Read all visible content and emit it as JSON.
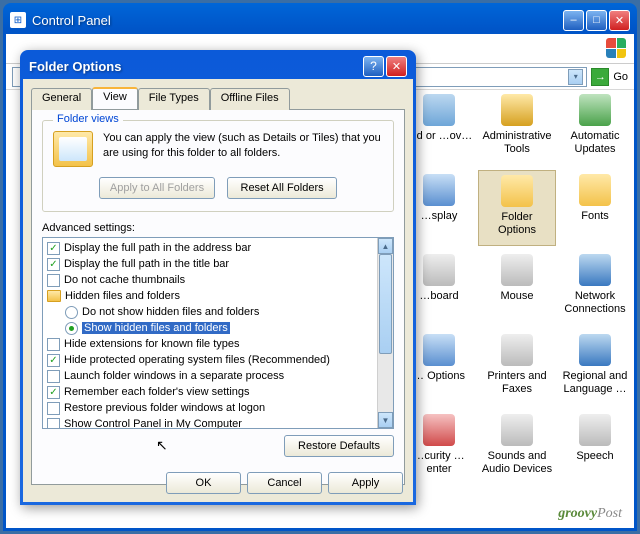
{
  "cp": {
    "title": "Control Panel",
    "go_label": "Go",
    "icons": {
      "r1c1": "…d or …ov…",
      "r1c2": "Administrative Tools",
      "r1c3": "Automatic Updates",
      "r2c1": "…splay",
      "r2c2": "Folder Options",
      "r2c3": "Fonts",
      "r3c1": "…board",
      "r3c2": "Mouse",
      "r3c3": "Network Connections",
      "r4c1": "… Options",
      "r4c2": "Printers and Faxes",
      "r4c3": "Regional and Language …",
      "r5c1": "…curity …enter",
      "r5c2": "Sounds and Audio Devices",
      "r5c3": "Speech"
    }
  },
  "dlg": {
    "title": "Folder Options",
    "tabs": {
      "general": "General",
      "view": "View",
      "filetypes": "File Types",
      "offline": "Offline Files"
    },
    "folder_views": {
      "legend": "Folder views",
      "desc": "You can apply the view (such as Details or Tiles) that you are using for this folder to all folders.",
      "apply_all": "Apply to All Folders",
      "reset_all": "Reset All Folders"
    },
    "advanced_label": "Advanced settings:",
    "tree": {
      "i0": "Display the full path in the address bar",
      "i1": "Display the full path in the title bar",
      "i2": "Do not cache thumbnails",
      "i3": "Hidden files and folders",
      "i4": "Do not show hidden files and folders",
      "i5": "Show hidden files and folders",
      "i6": "Hide extensions for known file types",
      "i7": "Hide protected operating system files (Recommended)",
      "i8": "Launch folder windows in a separate process",
      "i9": "Remember each folder's view settings",
      "i10": "Restore previous folder windows at logon",
      "i11": "Show Control Panel in My Computer"
    },
    "restore_defaults": "Restore Defaults",
    "ok": "OK",
    "cancel": "Cancel",
    "apply": "Apply"
  },
  "watermark": {
    "a": "groovy",
    "b": "Post"
  },
  "colors": {
    "xp_blue": "#0b5ad9",
    "selection": "#316ac5",
    "face": "#ece9d8",
    "check_green": "#21a121"
  }
}
